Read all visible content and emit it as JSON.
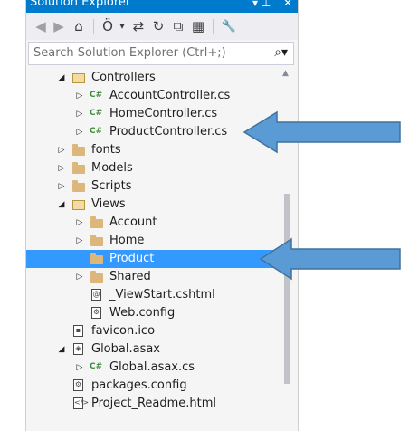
{
  "window": {
    "title": "Solution Explorer",
    "pin_glyph": "▾ ⊥",
    "close_glyph": "✕"
  },
  "toolbar": {
    "back": "◀",
    "forward": "▶",
    "home": "⌂",
    "history": "Ö",
    "history_dropdown": "▾",
    "sync": "⇄",
    "refresh": "↻",
    "collapse": "⧉",
    "show_all": "▦",
    "properties": "🔧"
  },
  "search": {
    "placeholder": "Search Solution Explorer (Ctrl+;)",
    "icon": "⌕▾"
  },
  "tree": [
    {
      "label": "Controllers",
      "icon": "folder-open",
      "expand": "◢"
    },
    {
      "label": "AccountController.cs",
      "icon": "cs-file",
      "expand": "▷"
    },
    {
      "label": "HomeController.cs",
      "icon": "cs-file",
      "expand": "▷"
    },
    {
      "label": "ProductController.cs",
      "icon": "cs-file",
      "expand": "▷"
    },
    {
      "label": "fonts",
      "icon": "folder",
      "expand": "▷"
    },
    {
      "label": "Models",
      "icon": "folder",
      "expand": "▷"
    },
    {
      "label": "Scripts",
      "icon": "folder",
      "expand": "▷"
    },
    {
      "label": "Views",
      "icon": "folder-open",
      "expand": "◢"
    },
    {
      "label": "Account",
      "icon": "folder",
      "expand": "▷"
    },
    {
      "label": "Home",
      "icon": "folder",
      "expand": "▷"
    },
    {
      "label": "Product",
      "icon": "folder",
      "expand": ""
    },
    {
      "label": "Shared",
      "icon": "folder",
      "expand": "▷"
    },
    {
      "label": "_ViewStart.cshtml",
      "icon": "cshtml-file",
      "expand": ""
    },
    {
      "label": "Web.config",
      "icon": "config-file",
      "expand": ""
    },
    {
      "label": "favicon.ico",
      "icon": "ico-file",
      "expand": ""
    },
    {
      "label": "Global.asax",
      "icon": "asax-file",
      "expand": "◢"
    },
    {
      "label": "Global.asax.cs",
      "icon": "cs-file",
      "expand": "▷"
    },
    {
      "label": "packages.config",
      "icon": "config-file",
      "expand": ""
    },
    {
      "label": "Project_Readme.html",
      "icon": "html-file",
      "expand": ""
    }
  ],
  "colors": {
    "accent": "#007acc",
    "selection": "#3399ff",
    "arrow_fill": "#5b9bd5",
    "arrow_stroke": "#41719c"
  }
}
